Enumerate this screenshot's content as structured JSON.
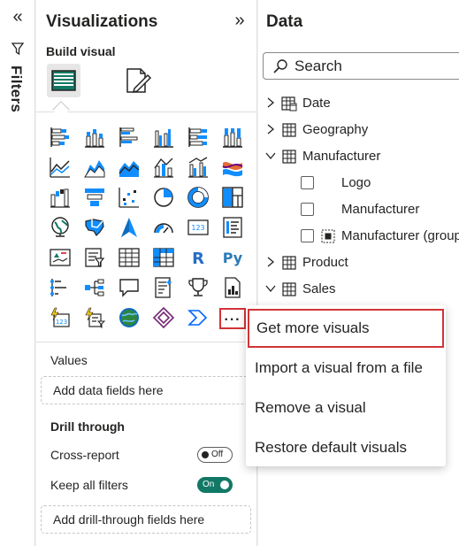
{
  "filters": {
    "label": "Filters",
    "collapse_icon": "double-chevron-left-icon",
    "funnel_icon": "funnel-icon"
  },
  "visualizations": {
    "title": "Visualizations",
    "expand_icon": "double-chevron-right-icon",
    "build_visual_label": "Build visual",
    "build_buttons": [
      "build-visual-icon",
      "format-visual-icon"
    ],
    "icons": [
      [
        "stacked-bar-chart-icon",
        "stacked-column-chart-icon",
        "clustered-bar-chart-icon",
        "clustered-column-chart-icon",
        "100-stacked-bar-chart-icon",
        "100-stacked-column-chart-icon"
      ],
      [
        "line-chart-icon",
        "area-chart-icon",
        "stacked-area-chart-icon",
        "line-and-stacked-column-chart-icon",
        "line-and-clustered-column-chart-icon",
        "ribbon-chart-icon"
      ],
      [
        "waterfall-chart-icon",
        "funnel-chart-icon",
        "scatter-chart-icon",
        "pie-chart-icon",
        "donut-chart-icon",
        "treemap-icon"
      ],
      [
        "map-icon",
        "filled-map-icon",
        "azure-map-icon",
        "gauge-icon",
        "card-icon",
        "multi-row-card-icon"
      ],
      [
        "kpi-icon",
        "slicer-icon",
        "table-icon",
        "matrix-icon",
        "r-visual-icon",
        "python-visual-icon"
      ],
      [
        "key-influencers-icon",
        "decomposition-tree-icon",
        "qa-icon",
        "smart-narrative-icon",
        "metrics-icon",
        "paginated-report-icon"
      ],
      [
        "power-apps-icon",
        "power-automate-icon",
        "arcgis-map-icon",
        "power-apps-diamond-icon",
        "power-automate-chevron-icon",
        "more-options-icon"
      ]
    ],
    "more_label": "···",
    "values_label": "Values",
    "values_placeholder": "Add data fields here",
    "drill_through_label": "Drill through",
    "cross_report_label": "Cross-report",
    "cross_report_state": "Off",
    "keep_filters_label": "Keep all filters",
    "keep_filters_state": "On",
    "drill_placeholder": "Add drill-through fields here"
  },
  "data": {
    "title": "Data",
    "search_placeholder": "Search",
    "tree": [
      {
        "label": "Date",
        "expanded": false,
        "icon": "date-table-icon"
      },
      {
        "label": "Geography",
        "expanded": false,
        "icon": "table-icon"
      },
      {
        "label": "Manufacturer",
        "expanded": true,
        "icon": "table-icon"
      },
      {
        "label": "Logo",
        "field": true
      },
      {
        "label": "Manufacturer",
        "field": true
      },
      {
        "label": "Manufacturer (group",
        "field": true,
        "icon": "group-icon"
      },
      {
        "label": "Product",
        "expanded": false,
        "icon": "table-icon"
      },
      {
        "label": "Sales",
        "expanded": true,
        "icon": "table-icon"
      }
    ]
  },
  "context_menu": {
    "items": [
      "Get more visuals",
      "Import a visual from a file",
      "Remove a visual",
      "Restore default visuals"
    ],
    "highlighted": "Get more visuals"
  },
  "colors": {
    "accent_red": "#d13438",
    "toggle_on": "#117865",
    "icon_blue": "#118dff",
    "icon_dark": "#252423",
    "icon_yellow": "#f2c811"
  }
}
